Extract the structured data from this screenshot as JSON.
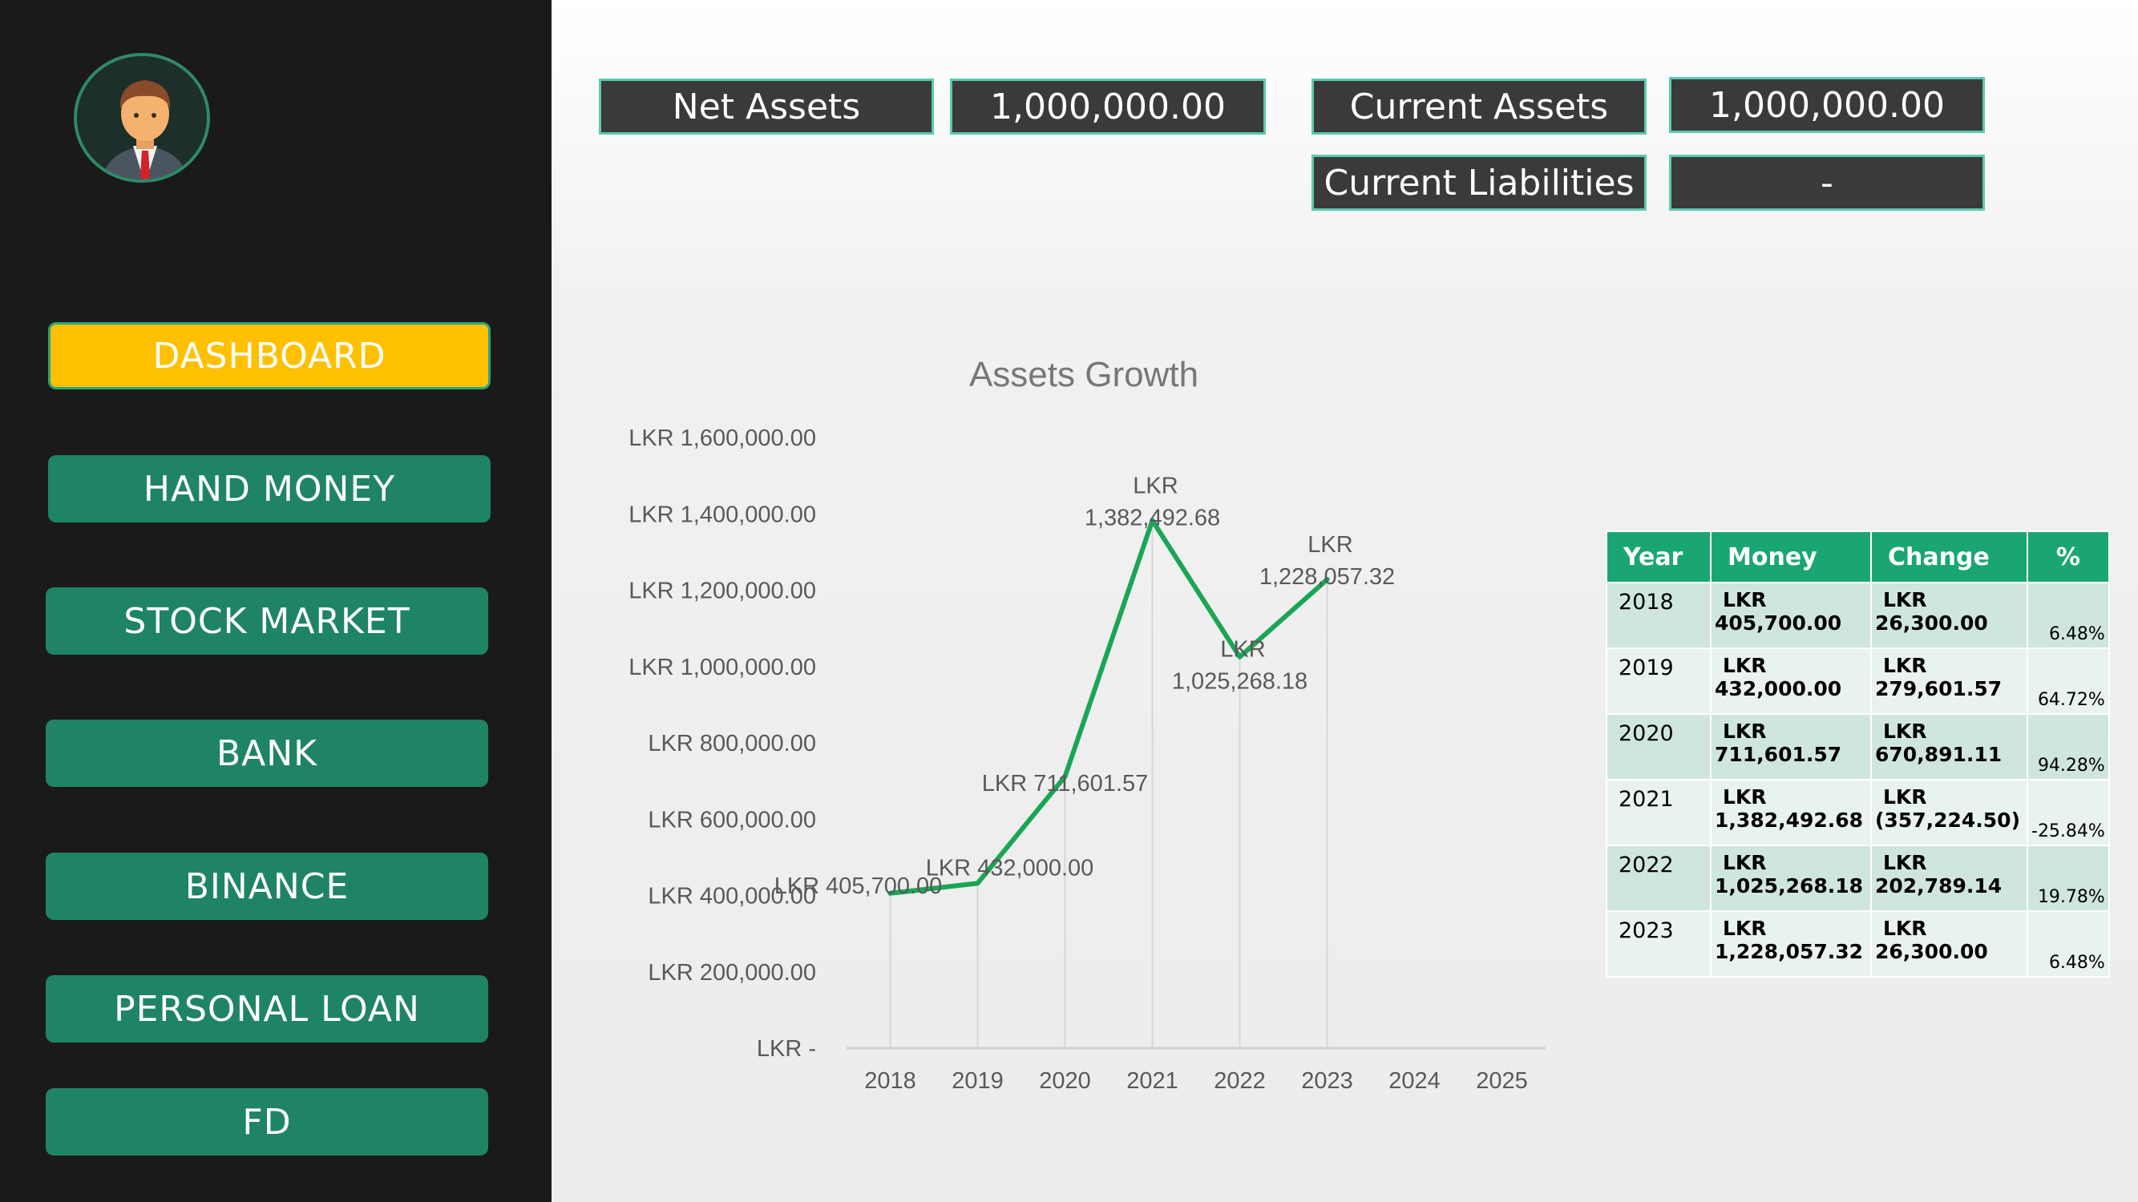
{
  "sidebar": {
    "items": [
      {
        "label": "DASHBOARD",
        "active": true
      },
      {
        "label": "HAND MONEY"
      },
      {
        "label": "STOCK MARKET"
      },
      {
        "label": "BANK"
      },
      {
        "label": "BINANCE"
      },
      {
        "label": "PERSONAL LOAN"
      },
      {
        "label": "FD"
      }
    ]
  },
  "kpis": {
    "net_assets_label": "Net Assets",
    "net_assets_value": "1,000,000.00",
    "current_assets_label": "Current Assets",
    "current_assets_value": "1,000,000.00",
    "current_liabilities_label": "Current Liabilities",
    "current_liabilities_value": "-"
  },
  "chart_data": {
    "type": "line",
    "title": "Assets Growth",
    "categories": [
      "2018",
      "2019",
      "2020",
      "2021",
      "2022",
      "2023",
      "2024",
      "2025"
    ],
    "series": [
      {
        "values": [
          405700.0,
          432000.0,
          711601.57,
          1382492.68,
          1025268.18,
          1228057.32
        ]
      }
    ],
    "data_labels": [
      "LKR 405,700.00",
      "LKR 432,000.00",
      "LKR 711,601.57",
      "LKR 1,382,492.68",
      "LKR 1,025,268.18",
      "LKR 1,228,057.32"
    ],
    "y_ticks": [
      "LKR -",
      "LKR 200,000.00",
      "LKR 400,000.00",
      "LKR 600,000.00",
      "LKR 800,000.00",
      "LKR 1,000,000.00",
      "LKR 1,200,000.00",
      "LKR 1,400,000.00",
      "LKR 1,600,000.00"
    ],
    "ylim": [
      0,
      1600000
    ],
    "line_color": "#1aa655",
    "grid": false,
    "legend": "none"
  },
  "table": {
    "headers": [
      "Year",
      "Money",
      "Change",
      "%"
    ],
    "rows": [
      {
        "year": "2018",
        "money_cur": "LKR",
        "money": "405,700.00",
        "change_cur": "LKR",
        "change": "26,300.00",
        "pct": "6.48%"
      },
      {
        "year": "2019",
        "money_cur": "LKR",
        "money": "432,000.00",
        "change_cur": "LKR",
        "change": "279,601.57",
        "pct": "64.72%"
      },
      {
        "year": "2020",
        "money_cur": "LKR",
        "money": "711,601.57",
        "change_cur": "LKR",
        "change": "670,891.11",
        "pct": "94.28%"
      },
      {
        "year": "2021",
        "money_cur": "LKR",
        "money": "1,382,492.68",
        "change_cur": "LKR",
        "change": "(357,224.50)",
        "pct": "-25.84%"
      },
      {
        "year": "2022",
        "money_cur": "LKR",
        "money": "1,025,268.18",
        "change_cur": "LKR",
        "change": "202,789.14",
        "pct": "19.78%"
      },
      {
        "year": "2023",
        "money_cur": "LKR",
        "money": "1,228,057.32",
        "change_cur": "LKR",
        "change": "26,300.00",
        "pct": "6.48%"
      }
    ]
  },
  "colors": {
    "sidebar_bg": "#1a1a1a",
    "nav_button": "#1f8465",
    "nav_active": "#ffc000",
    "kpi_bg": "#3a3a3a",
    "kpi_border": "#5bc9b0",
    "table_header": "#1aa673"
  },
  "icons": {
    "avatar": "businessman-avatar-icon"
  }
}
